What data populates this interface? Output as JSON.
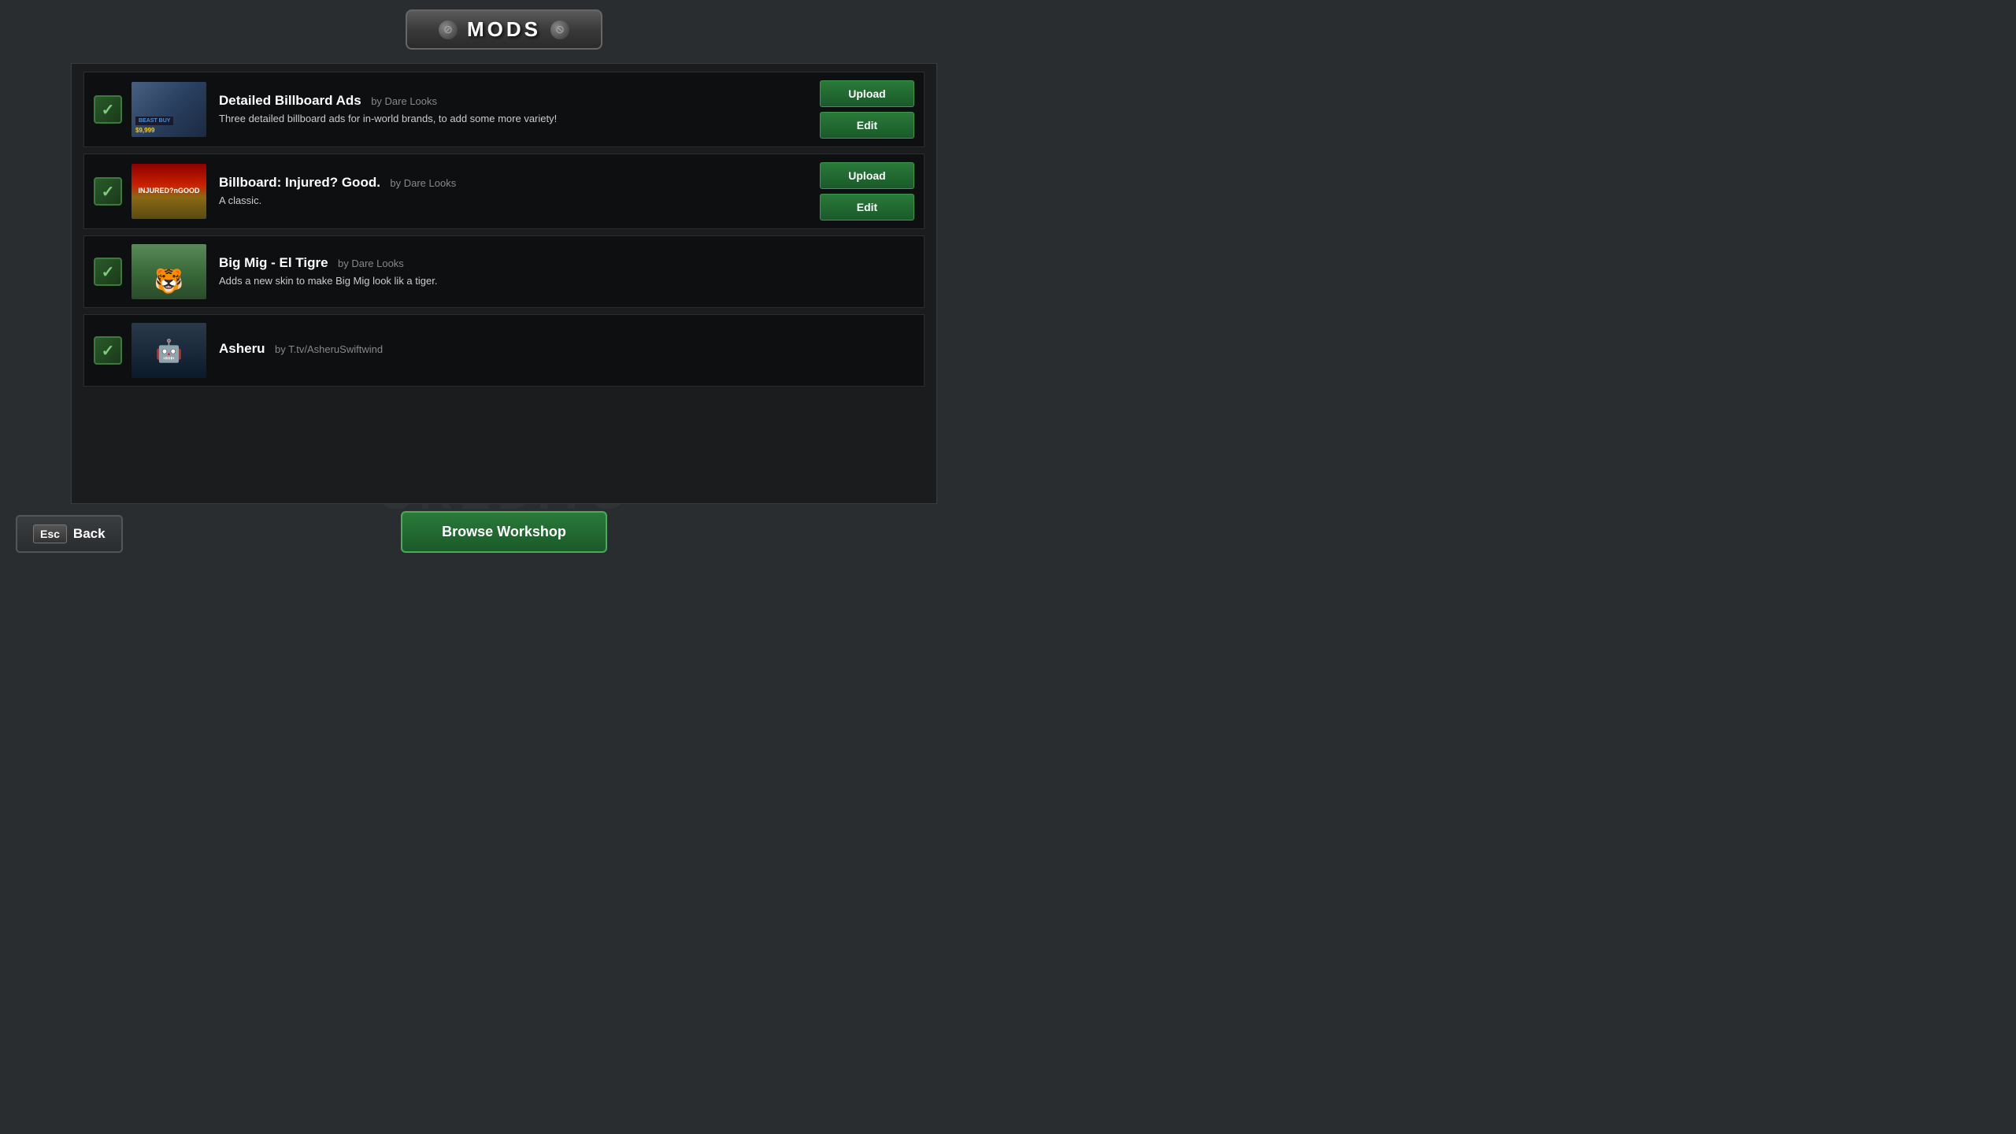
{
  "title": {
    "label": "MODS",
    "icon_left": "⊘",
    "icon_right": "⊘"
  },
  "watermarks": [
    "MODS",
    "INFO",
    "CREDITS"
  ],
  "mods": [
    {
      "id": "detailed-billboard-ads",
      "title": "Detailed Billboard Ads",
      "author": "by Dare Looks",
      "description": "Three detailed billboard ads for in-world brands, to add some more variety!",
      "enabled": true,
      "has_upload": true,
      "has_edit": true,
      "thumb_type": "billboard-ads"
    },
    {
      "id": "billboard-injured-good",
      "title": "Billboard: Injured? Good.",
      "author": "by Dare Looks",
      "description": "A classic.",
      "enabled": true,
      "has_upload": true,
      "has_edit": true,
      "thumb_type": "injured"
    },
    {
      "id": "big-mig-el-tigre",
      "title": "Big Mig - El Tigre",
      "author": "by Dare Looks",
      "description": "Adds a new skin to make Big Mig look lik a tiger.",
      "enabled": true,
      "has_upload": false,
      "has_edit": false,
      "thumb_type": "bigmig"
    },
    {
      "id": "asheru",
      "title": "Asheru",
      "author": "by T.tv/AsheruSwiftwind",
      "description": "",
      "enabled": true,
      "has_upload": false,
      "has_edit": false,
      "thumb_type": "asheru"
    }
  ],
  "buttons": {
    "upload_label": "Upload",
    "edit_label": "Edit",
    "browse_workshop_label": "Browse Workshop",
    "back_label": "Back",
    "esc_label": "Esc"
  },
  "credits_watermark": "CREDITS"
}
